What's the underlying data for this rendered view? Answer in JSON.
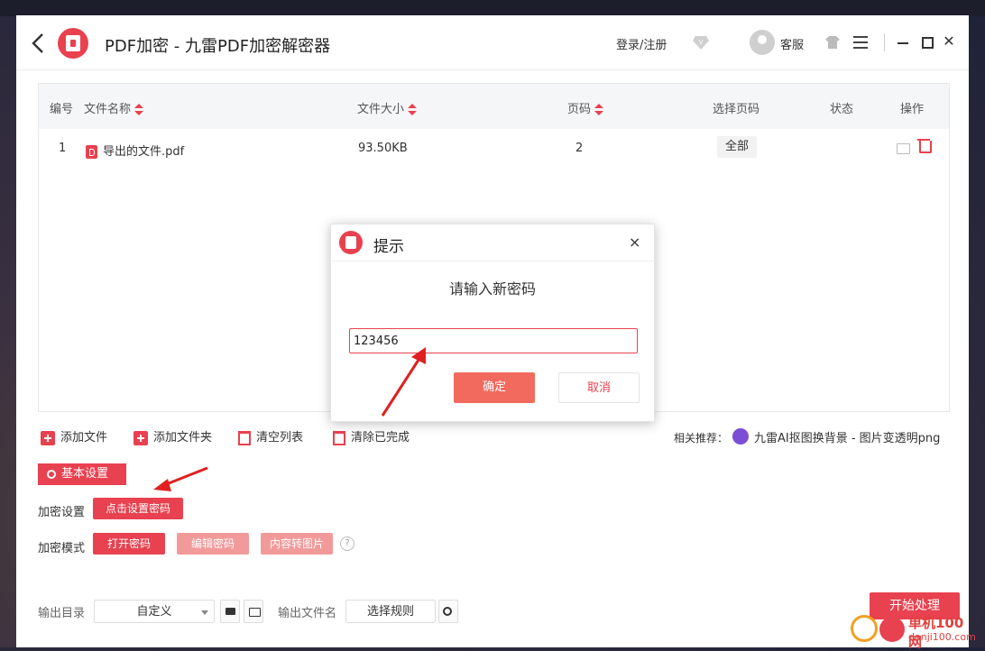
{
  "window": {
    "title": "PDF加密 - 九雷PDF加密解密器",
    "login": "登录/注册",
    "service": "客服"
  },
  "table": {
    "headers": {
      "no": "编号",
      "name": "文件名称",
      "size": "文件大小",
      "pages": "页码",
      "select_pages": "选择页码",
      "status": "状态",
      "action": "操作"
    },
    "rows": [
      {
        "no": "1",
        "name": "导出的文件.pdf",
        "size": "93.50KB",
        "pages": "2",
        "select_pages": "全部",
        "status": ""
      }
    ]
  },
  "toolbar": {
    "add_file": "添加文件",
    "add_folder": "添加文件夹",
    "clear_list": "清空列表",
    "clear_done": "清除已完成",
    "recommend_label": "相关推荐：",
    "recommend_link": "九雷AI抠图换背景 - 图片变透明png"
  },
  "settings": {
    "section_title": "基本设置",
    "encrypt_label": "加密设置",
    "set_password_button": "点击设置密码",
    "mode_label": "加密模式",
    "mode_open": "打开密码",
    "mode_edit": "编辑密码",
    "mode_image": "内容转图片",
    "help": "?"
  },
  "bottom": {
    "output_dir_label": "输出目录",
    "output_dir_value": "自定义",
    "output_name_label": "输出文件名",
    "rule_button": "选择规则",
    "start_button": "开始处理"
  },
  "dialog": {
    "title": "提示",
    "close": "×",
    "prompt": "请输入新密码",
    "input_value": "123456",
    "ok": "确定",
    "cancel": "取消"
  },
  "watermark": {
    "brand": "单机100网",
    "url": "danji100.com"
  },
  "colors": {
    "accent": "#e8414f",
    "accent_light": "#f29a9a",
    "ok_button": "#f26a5e"
  }
}
